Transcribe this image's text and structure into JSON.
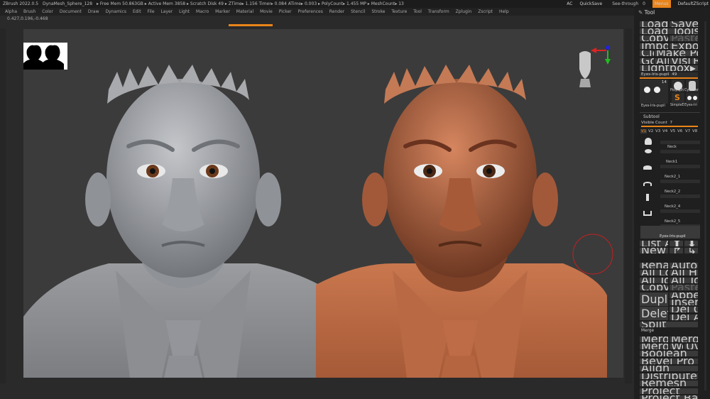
{
  "title_bar": {
    "app": "ZBrush 2022.0.5",
    "doc": "DynaMesh_Sphere_128",
    "stats": "▸ Free Mem 50.863GB ▸ Active Mem 3858 ▸ Scratch Disk 49 ▸ ZTime▸ 1.156 Timer▸ 0.084 ATime▸ 0.003 ▸ PolyCount▸ 1.455 MP ▸ MeshCount▸ 13",
    "ac": "AC",
    "quicksave": "QuickSave",
    "see_through": "See-through",
    "see_through_value": "0",
    "menus": "Menus",
    "default_script": "DefaultZScript"
  },
  "menus": [
    "Alpha",
    "Brush",
    "Color",
    "Document",
    "Draw",
    "Dynamics",
    "Edit",
    "File",
    "Layer",
    "Light",
    "Macro",
    "Marker",
    "Material",
    "Movie",
    "Picker",
    "Preferences",
    "Render",
    "Stencil",
    "Stroke",
    "Texture",
    "Tool",
    "Transform",
    "Zplugin",
    "Zscript",
    "Help"
  ],
  "coords": "0.427,0.196,-0.468",
  "tool_panel": {
    "title": "Tool",
    "load_tool": "Load Tool",
    "save_as": "Save As",
    "load_from_project": "Load Tools From Project",
    "copy_tool": "Copy Tool",
    "paste_tool": "Paste Tool",
    "import": "Import",
    "export": "Export",
    "clone": "Clone",
    "make_polymesh": "Make PolyMesh3D",
    "goz": "GoZ",
    "all": "All",
    "visible": "Visible",
    "r": "R",
    "lightbox_tools": "Lightbox▸Tools",
    "current_tool": "Eyes-Iris-pupil",
    "current_tool_value": "49",
    "tool_count": "14",
    "thumb_names": [
      "Eyes-Iris-pupil",
      "PolySph",
      "Cylinder",
      "SimpleE",
      "Eyes-Iri"
    ]
  },
  "subtool": {
    "title": "Subtool",
    "visible_count_label": "Visible Count",
    "visible_count": "7",
    "versions": [
      "V1",
      "V2",
      "V3",
      "V4",
      "V5",
      "V6",
      "V7",
      "V8"
    ],
    "items": [
      "Neck",
      "Neck1",
      "Neck2_1",
      "Neck2_2",
      "Neck2_4",
      "Neck2_5",
      "Eyes-Iris-pupil"
    ],
    "list_all": "List All",
    "new_folder": "New Folder",
    "rename": "Rename",
    "autoreorder": "AutoReorder",
    "all_low": "All Low",
    "all_high": "All High",
    "all_to_home": "All To Home",
    "all_to_target": "All To Target",
    "copy": "Copy",
    "paste": "Paste",
    "append": "Append",
    "duplicate": "Duplicate",
    "insert": "Insert",
    "delete": "Delete",
    "del_other": "Del Other",
    "del_all": "Del All",
    "split": "Split",
    "merge": "Merge",
    "merge_down": "MergeDown",
    "merge_similar": "MergeSimilar",
    "merge_visible": "MergeVisible",
    "weld": "Weld",
    "uv": "Uv",
    "sections": [
      "Boolean",
      "Bevel Pro",
      "Align",
      "Distribute",
      "Remesh",
      "Project",
      "Project BasRelief"
    ]
  },
  "colors": {
    "accent": "#e8841a",
    "skin_gray": "#a3a6ab",
    "skin_clay": "#b96a45"
  }
}
